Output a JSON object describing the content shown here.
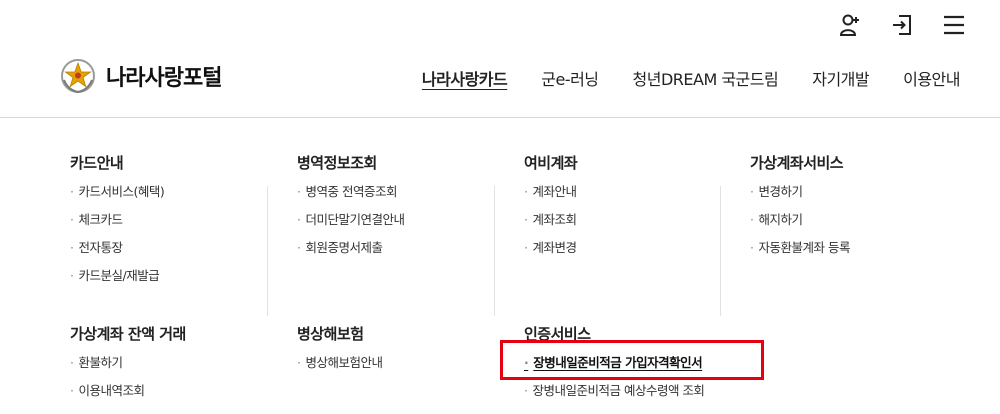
{
  "utility": {
    "icons": [
      "user-plus-icon",
      "login-icon",
      "hamburger-menu-icon"
    ]
  },
  "header": {
    "logo_text": "나라사랑포털",
    "nav": [
      {
        "label": "나라사랑카드",
        "active": true
      },
      {
        "label": "군e-러닝"
      },
      {
        "label": "청년DREAM 국군드림"
      },
      {
        "label": "자기개발"
      },
      {
        "label": "이용안내"
      }
    ]
  },
  "menu": {
    "card": {
      "title": "카드안내",
      "items": [
        "카드서비스(혜택)",
        "체크카드",
        "전자통장",
        "카드분실/재발급"
      ]
    },
    "military": {
      "title": "병역정보조회",
      "items": [
        "병역중 전역증조회",
        "더미단말기연결안내",
        "회원증명서제출"
      ]
    },
    "travel": {
      "title": "여비계좌",
      "items": [
        "계좌안내",
        "계좌조회",
        "계좌변경"
      ]
    },
    "virtual": {
      "title": "가상계좌서비스",
      "items": [
        "변경하기",
        "해지하기",
        "자동환불계좌 등록"
      ]
    },
    "balance": {
      "title": "가상계좌 잔액 거래",
      "items": [
        "환불하기",
        "이용내역조회"
      ]
    },
    "insurance": {
      "title": "병상해보험",
      "items": [
        "병상해보험안내"
      ]
    },
    "cert": {
      "title": "인증서비스",
      "items": [
        "장병내일준비적금 가입자격확인서",
        "장병내일준비적금 예상수령액 조회"
      ]
    }
  },
  "colors": {
    "highlight": "#e50012",
    "divider": "#d6d6d6"
  }
}
